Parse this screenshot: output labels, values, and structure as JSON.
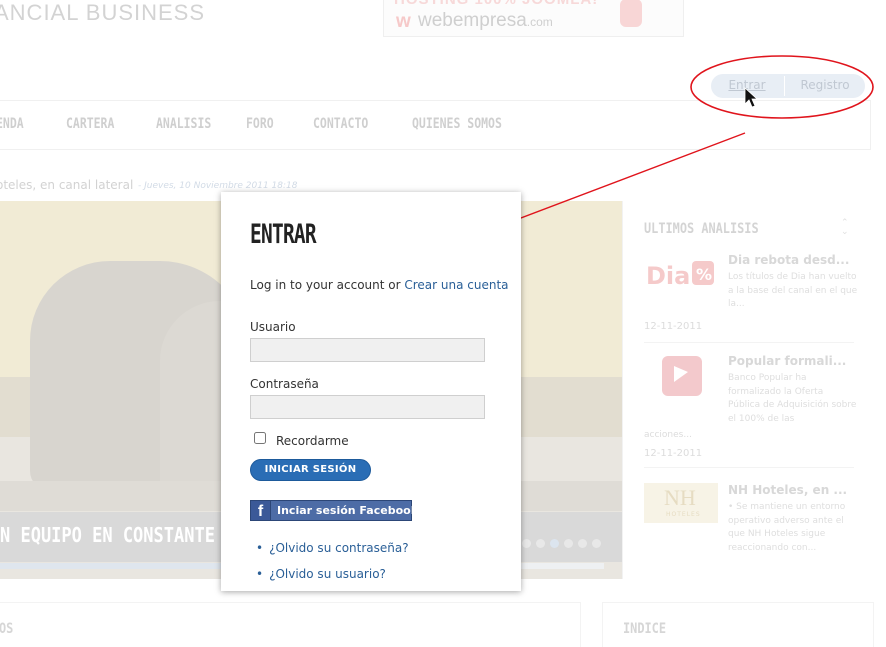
{
  "site": {
    "brand_text": "ANCIAL BUSINESS"
  },
  "ad": {
    "top_text": "HOSTING 100% JOOMLA!",
    "logo_mark": "w",
    "logo_text": "webempresa",
    "logo_suffix": ".com"
  },
  "auth": {
    "login_label": "Entrar",
    "register_label": "Registro"
  },
  "nav": {
    "items": [
      "ENDA",
      "CARTERA",
      "ANALISIS",
      "FORO",
      "CONTACTO",
      "QUIENES SOMOS"
    ]
  },
  "ticker": {
    "text": "oteles, en canal lateral",
    "date": "- Jueves, 10 Noviembre 2011 18:18"
  },
  "slider": {
    "caption": "N EQUIPO EN CONSTANTE CRECIMIENTO",
    "dots": 6,
    "active_dot": 2,
    "progress_fraction": 0.45
  },
  "sidebar": {
    "title": "ULTIMOS ANALISIS",
    "items": [
      {
        "headline": "Dia rebota desd...",
        "text": "Los títulos de Dia han vuelto a la base del canal en el que la...",
        "date": "12-11-2011",
        "thumb_icon": "dia-logo-icon"
      },
      {
        "headline": "Popular formali...",
        "text": " Banco Popular ha formalizado la Oferta Pública de Adquisición sobre el 100% de las",
        "text_overflow": "acciones...",
        "date": "12-11-2011",
        "thumb_icon": "banco-popular-logo-icon"
      },
      {
        "headline": "NH Hoteles, en ...",
        "text": "• Se mantiene un entorno operativo adverso ante el que NH Hoteles sigue reaccionando con...",
        "thumb_icon": "nh-hoteles-logo-icon",
        "thumb_text": "NH",
        "thumb_sub": "HOTELES"
      }
    ]
  },
  "bottom": {
    "left_title": "OS",
    "right_title": "INDICE"
  },
  "login_modal": {
    "title": "ENTRAR",
    "intro_text": "Log in to your account or ",
    "create_account_link": "Crear una cuenta",
    "username_label": "Usuario",
    "username_value": "",
    "password_label": "Contraseña",
    "password_value": "",
    "remember_label": "Recordarme",
    "remember_checked": false,
    "submit_label": "INICIAR SESIÓN",
    "facebook_icon_letter": "f",
    "facebook_label": "Inciar sesión Facebook",
    "forgot_password_link": "¿Olvido su contraseña?",
    "forgot_username_link": "¿Olvido su usuario?"
  },
  "colors": {
    "annotation_red": "#e0141c",
    "submit_blue": "#2a6db5",
    "link_blue": "#2a5f97",
    "facebook_blue": "#4d6ca6"
  }
}
